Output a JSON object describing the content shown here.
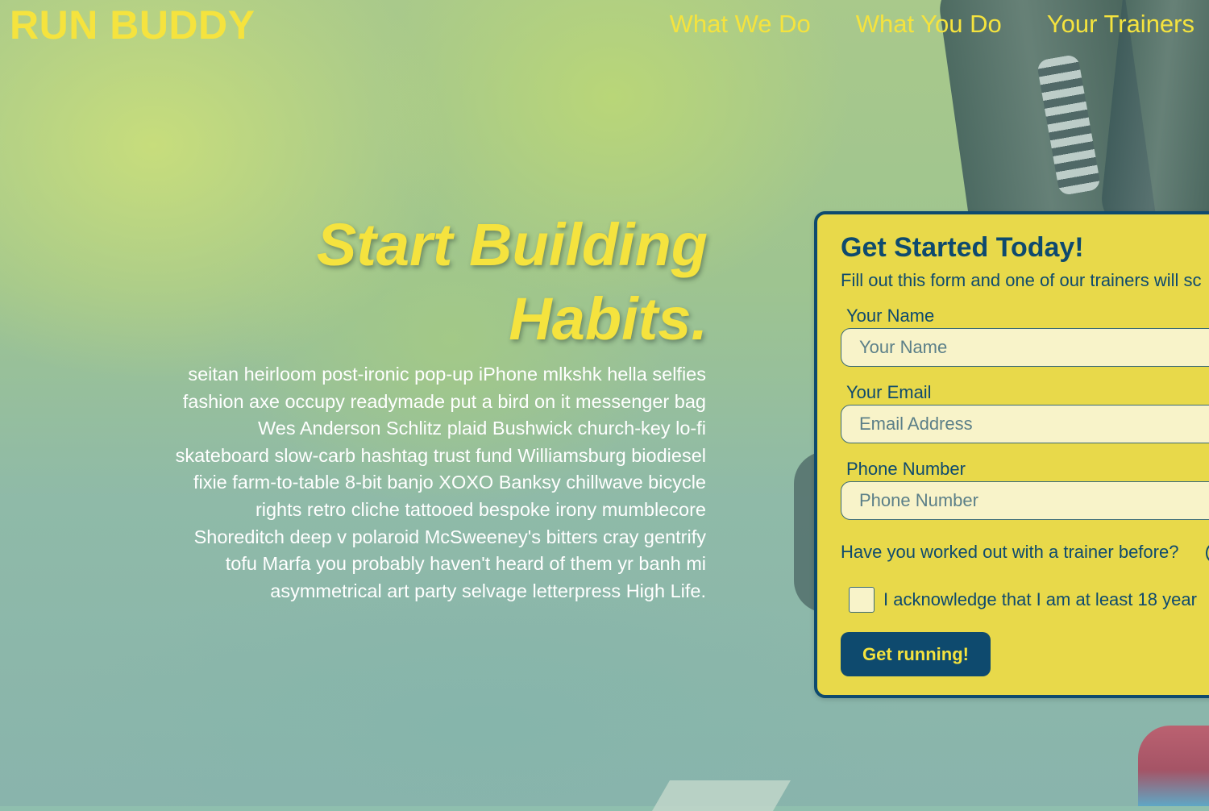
{
  "header": {
    "brand": "RUN BUDDY",
    "nav": [
      "What We Do",
      "What You Do",
      "Your Trainers"
    ]
  },
  "hero": {
    "headline_line1": "Start Building",
    "headline_line2": "Habits.",
    "body": "seitan heirloom post-ironic pop-up iPhone mlkshk hella selfies fashion axe occupy readymade put a bird on it messenger bag Wes Anderson Schlitz plaid Bushwick church-key lo-fi skateboard slow-carb hashtag trust fund Williamsburg biodiesel fixie farm-to-table 8-bit banjo XOXO Banksy chillwave bicycle rights retro cliche tattooed bespoke irony mumblecore Shoreditch deep v polaroid McSweeney's bitters cray gentrify tofu Marfa you probably haven't heard of them yr banh mi asymmetrical art party selvage letterpress High Life."
  },
  "form": {
    "title": "Get Started Today!",
    "subtitle": "Fill out this form and one of our trainers will sc",
    "name_label": "Your Name",
    "name_placeholder": "Your Name",
    "email_label": "Your Email",
    "email_placeholder": "Email Address",
    "phone_label": "Phone Number",
    "phone_placeholder": "Phone Number",
    "question": "Have you worked out with a trainer before?",
    "acknowledge": "I acknowledge that I am at least 18 year",
    "submit_label": "Get running!"
  },
  "colors": {
    "accent": "#f5e33e",
    "navy": "#0e4a6e",
    "form_bg": "#e8d94a"
  }
}
